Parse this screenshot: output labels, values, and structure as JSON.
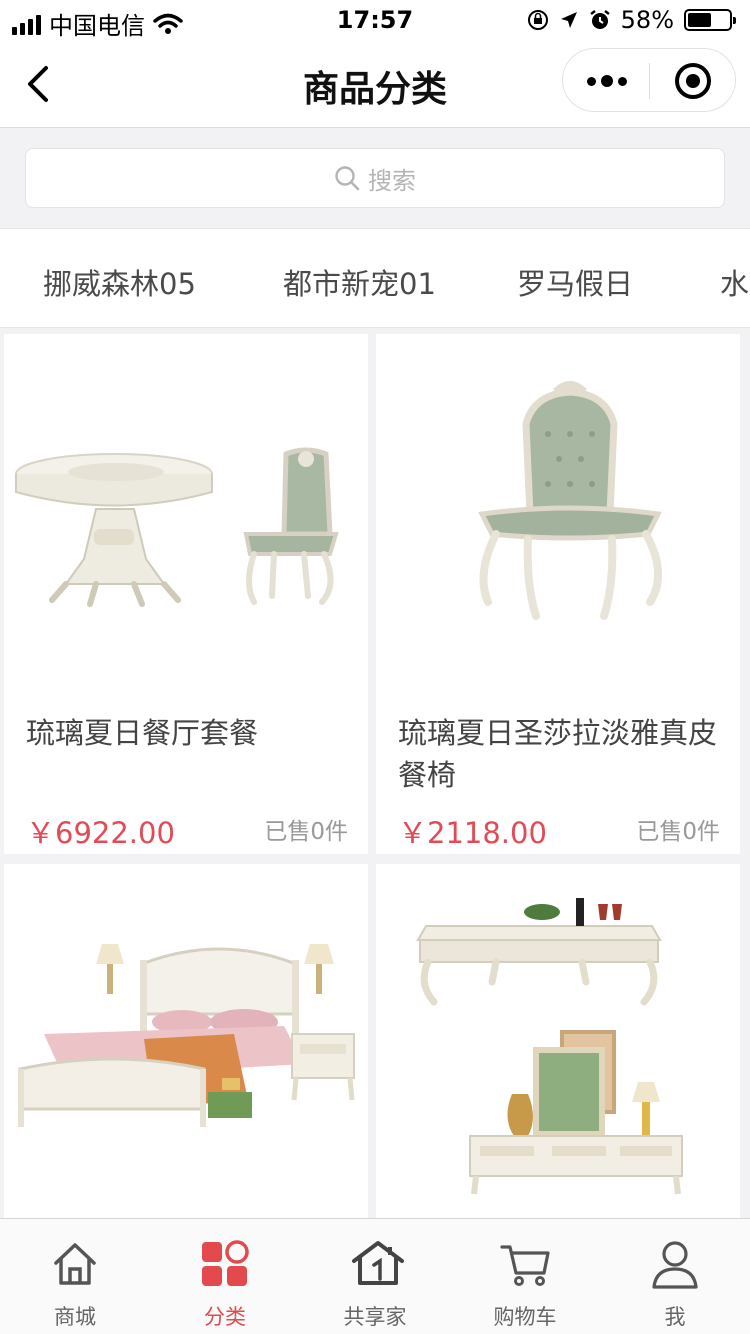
{
  "status_bar": {
    "carrier": "中国电信",
    "time": "17:57",
    "battery": "58%",
    "battery_level": 0.58
  },
  "nav": {
    "title": "商品分类"
  },
  "search": {
    "placeholder": "搜索"
  },
  "categories": [
    "挪威森林05",
    "都市新宠01",
    "罗马假日",
    "水"
  ],
  "products": [
    {
      "name": "琉璃夏日餐厅套餐",
      "price": "￥6922.00",
      "sold": "已售0件"
    },
    {
      "name": "琉璃夏日圣莎拉淡雅真皮餐椅",
      "price": "￥2118.00",
      "sold": "已售0件"
    },
    {
      "name": "",
      "price": "",
      "sold": ""
    },
    {
      "name": "",
      "price": "",
      "sold": ""
    }
  ],
  "tabbar": [
    {
      "label": "商城",
      "icon": "home-icon",
      "active": false
    },
    {
      "label": "分类",
      "icon": "category-icon",
      "active": true
    },
    {
      "label": "共享家",
      "icon": "share-home-icon",
      "active": false
    },
    {
      "label": "购物车",
      "icon": "cart-icon",
      "active": false
    },
    {
      "label": "我",
      "icon": "user-icon",
      "active": false
    }
  ],
  "colors": {
    "accent": "#e24a4e",
    "price": "#e34a56",
    "background": "#f2f2f4"
  }
}
